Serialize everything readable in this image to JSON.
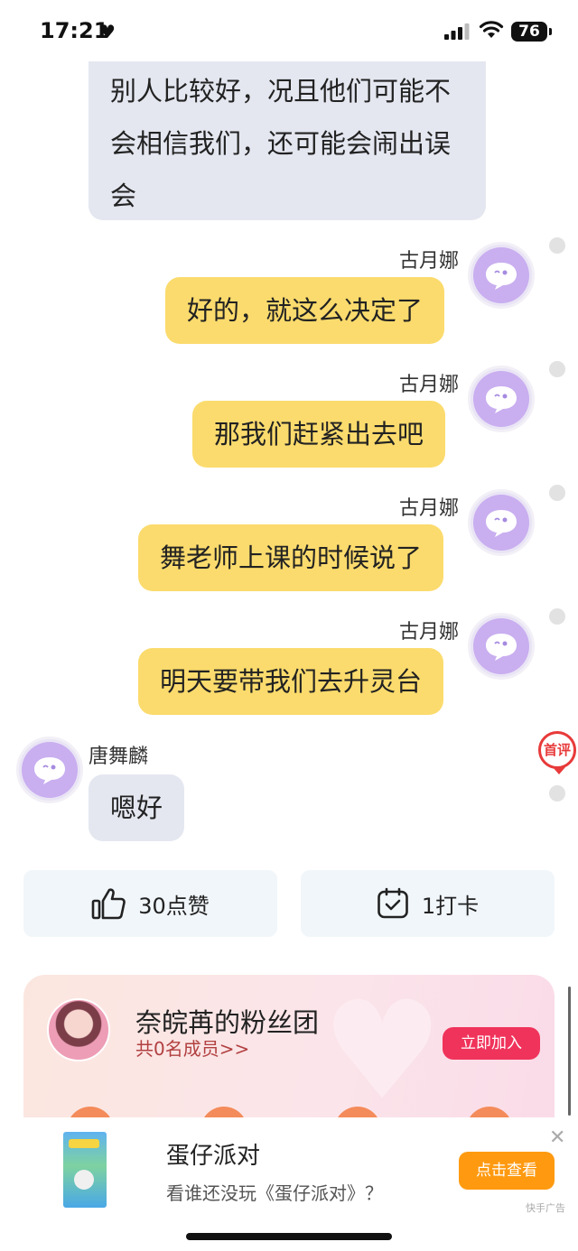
{
  "status_bar": {
    "time": "17:21",
    "battery": "76"
  },
  "messages": [
    {
      "side": "left",
      "sender": "",
      "text_lines": [
        "别人比较好，况且他们可能不",
        "会相信我们，还可能会闹出误",
        "会"
      ]
    },
    {
      "side": "right",
      "sender": "古月娜",
      "text": "好的，就这么决定了"
    },
    {
      "side": "right",
      "sender": "古月娜",
      "text": "那我们赶紧出去吧"
    },
    {
      "side": "right",
      "sender": "古月娜",
      "text": "舞老师上课的时候说了"
    },
    {
      "side": "right",
      "sender": "古月娜",
      "text": "明天要带我们去升灵台"
    },
    {
      "side": "left",
      "sender": "唐舞麟",
      "text": "嗯好"
    }
  ],
  "first_comment_badge": "首评",
  "actions": {
    "like_label": "30点赞",
    "checkin_label": "1打卡"
  },
  "fan_club": {
    "title": "奈皖苒的粉丝团",
    "members": "共0名成员>>",
    "join_label": "立即加入"
  },
  "ad": {
    "title": "蛋仔派对",
    "description": "看谁还没玩《蛋仔派对》？",
    "button": "点击查看",
    "label": "快手广告",
    "close": "✕"
  }
}
